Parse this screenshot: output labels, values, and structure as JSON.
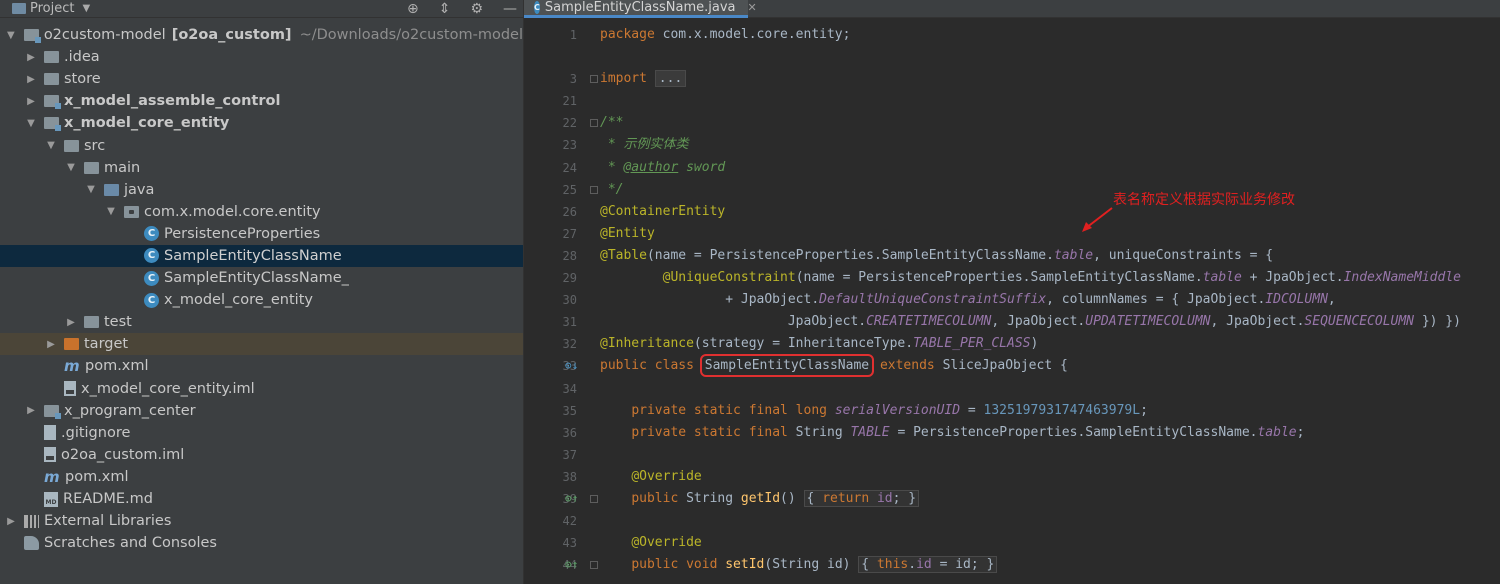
{
  "project_panel": {
    "title": "Project",
    "tree": [
      {
        "label": "o2custom-model",
        "bold_suffix": "[o2oa_custom]",
        "muted": "~/Downloads/o2custom-model",
        "indent": 0,
        "arrow": "down",
        "icon": "folder-module",
        "icon_name": "module-folder-icon"
      },
      {
        "label": ".idea",
        "indent": 1,
        "arrow": "right",
        "icon": "folder",
        "icon_name": "folder-icon"
      },
      {
        "label": "store",
        "indent": 1,
        "arrow": "right",
        "icon": "folder",
        "icon_name": "folder-icon"
      },
      {
        "label": "x_model_assemble_control",
        "indent": 1,
        "arrow": "right",
        "icon": "folder-module",
        "bold": true,
        "icon_name": "module-folder-icon"
      },
      {
        "label": "x_model_core_entity",
        "indent": 1,
        "arrow": "down",
        "icon": "folder-module",
        "bold": true,
        "icon_name": "module-folder-icon"
      },
      {
        "label": "src",
        "indent": 2,
        "arrow": "down",
        "icon": "folder",
        "icon_name": "folder-icon"
      },
      {
        "label": "main",
        "indent": 3,
        "arrow": "down",
        "icon": "folder",
        "icon_name": "folder-icon"
      },
      {
        "label": "java",
        "indent": 4,
        "arrow": "down",
        "icon": "folder-src",
        "icon_name": "source-folder-icon"
      },
      {
        "label": "com.x.model.core.entity",
        "indent": 5,
        "arrow": "down",
        "icon": "folder-pkg",
        "icon_name": "package-icon"
      },
      {
        "label": "PersistenceProperties",
        "indent": 6,
        "arrow": "none",
        "icon": "class",
        "icon_name": "class-icon"
      },
      {
        "label": "SampleEntityClassName",
        "indent": 6,
        "arrow": "none",
        "icon": "class",
        "selected": true,
        "icon_name": "class-icon"
      },
      {
        "label": "SampleEntityClassName_",
        "indent": 6,
        "arrow": "none",
        "icon": "class",
        "icon_name": "class-icon"
      },
      {
        "label": "x_model_core_entity",
        "indent": 6,
        "arrow": "none",
        "icon": "class",
        "icon_name": "class-icon"
      },
      {
        "label": "test",
        "indent": 3,
        "arrow": "right",
        "icon": "folder",
        "icon_name": "folder-icon"
      },
      {
        "label": "target",
        "indent": 2,
        "arrow": "right",
        "icon": "folder-target",
        "excluded": true,
        "icon_name": "excluded-folder-icon"
      },
      {
        "label": "pom.xml",
        "indent": 2,
        "arrow": "none",
        "icon": "maven",
        "icon_name": "maven-icon"
      },
      {
        "label": "x_model_core_entity.iml",
        "indent": 2,
        "arrow": "none",
        "icon": "file-iml",
        "icon_name": "iml-file-icon"
      },
      {
        "label": "x_program_center",
        "indent": 1,
        "arrow": "right",
        "icon": "folder-module",
        "icon_name": "module-folder-icon"
      },
      {
        "label": ".gitignore",
        "indent": 1,
        "arrow": "none",
        "icon": "file",
        "icon_name": "gitignore-icon"
      },
      {
        "label": "o2oa_custom.iml",
        "indent": 1,
        "arrow": "none",
        "icon": "file-iml",
        "icon_name": "iml-file-icon"
      },
      {
        "label": "pom.xml",
        "indent": 1,
        "arrow": "none",
        "icon": "maven",
        "icon_name": "maven-icon"
      },
      {
        "label": "README.md",
        "indent": 1,
        "arrow": "none",
        "icon": "md",
        "icon_name": "markdown-icon"
      },
      {
        "label": "External Libraries",
        "indent": 0,
        "arrow": "right",
        "icon": "libs",
        "icon_name": "libraries-icon"
      },
      {
        "label": "Scratches and Consoles",
        "indent": 0,
        "arrow": "none",
        "icon": "scratch",
        "icon_name": "scratches-icon"
      }
    ]
  },
  "editor": {
    "tab_label": "SampleEntityClassName.java",
    "annotation_text": "表名称定义根据实际业务修改",
    "lines": [
      {
        "n": "1",
        "html": "<span class='kw'>package</span> com.x.model.core.entity;"
      },
      {
        "n": "",
        "html": ""
      },
      {
        "n": "3",
        "html": "<span class='kw'>import</span> <span class='fold-box'>...</span>",
        "fold": true
      },
      {
        "n": "21",
        "html": ""
      },
      {
        "n": "22",
        "html": "<span class='doc'>/**</span>",
        "fold": true
      },
      {
        "n": "23",
        "html": "<span class='doc'> * 示例实体类</span>"
      },
      {
        "n": "24",
        "html": "<span class='doc'> * </span><span class='doctag'>@author</span><span class='doc'> sword</span>"
      },
      {
        "n": "25",
        "html": "<span class='doc'> */</span>",
        "fold": true
      },
      {
        "n": "26",
        "html": "<span class='an'>@ContainerEntity</span>"
      },
      {
        "n": "27",
        "html": "<span class='an'>@Entity</span>"
      },
      {
        "n": "28",
        "html": "<span class='an'>@Table</span>(name = PersistenceProperties.SampleEntityClassName.<span class='st'>table</span>, uniqueConstraints = {"
      },
      {
        "n": "29",
        "html": "        <span class='an'>@UniqueConstraint</span>(name = PersistenceProperties.SampleEntityClassName.<span class='st'>table</span> + JpaObject.<span class='st'>IndexNameMiddle</span>"
      },
      {
        "n": "30",
        "html": "                + JpaObject.<span class='st'>DefaultUniqueConstraintSuffix</span>, columnNames = { JpaObject.<span class='st'>IDCOLUMN</span>,"
      },
      {
        "n": "31",
        "html": "                        JpaObject.<span class='st'>CREATETIMECOLUMN</span>, JpaObject.<span class='st'>UPDATETIMECOLUMN</span>, JpaObject.<span class='st'>SEQUENCECOLUMN</span> }) })"
      },
      {
        "n": "32",
        "html": "<span class='an'>@Inheritance</span>(strategy = InheritanceType.<span class='st'>TABLE_PER_CLASS</span>)"
      },
      {
        "n": "33",
        "html": "<span class='kw'>public class</span> <span class='class-highlight'>SampleEntityClassName</span> <span class='kw'>extends</span> SliceJpaObject {",
        "mark": "impl"
      },
      {
        "n": "34",
        "html": ""
      },
      {
        "n": "35",
        "html": "    <span class='kw'>private static final long</span> <span class='st'>serialVersionUID</span> = <span class='num'>1325197931747463979L</span>;"
      },
      {
        "n": "36",
        "html": "    <span class='kw'>private static final</span> String <span class='st'>TABLE</span> = PersistenceProperties.SampleEntityClassName.<span class='st'>table</span>;"
      },
      {
        "n": "37",
        "html": ""
      },
      {
        "n": "38",
        "html": "    <span class='an'>@Override</span>"
      },
      {
        "n": "39",
        "html": "    <span class='kw'>public</span> String <span class='fn'>getId</span>() <span class='brace-box'>{ <span class='kw'>return</span> <span class='fld'>id</span>; }</span>",
        "mark": "over",
        "fold": true
      },
      {
        "n": "42",
        "html": ""
      },
      {
        "n": "43",
        "html": "    <span class='an'>@Override</span>"
      },
      {
        "n": "44",
        "html": "    <span class='kw'>public void</span> <span class='fn'>setId</span>(String id) <span class='brace-box'>{ <span class='kw'>this</span>.<span class='fld'>id</span> = id; }</span>",
        "mark": "over",
        "fold": true
      }
    ]
  }
}
